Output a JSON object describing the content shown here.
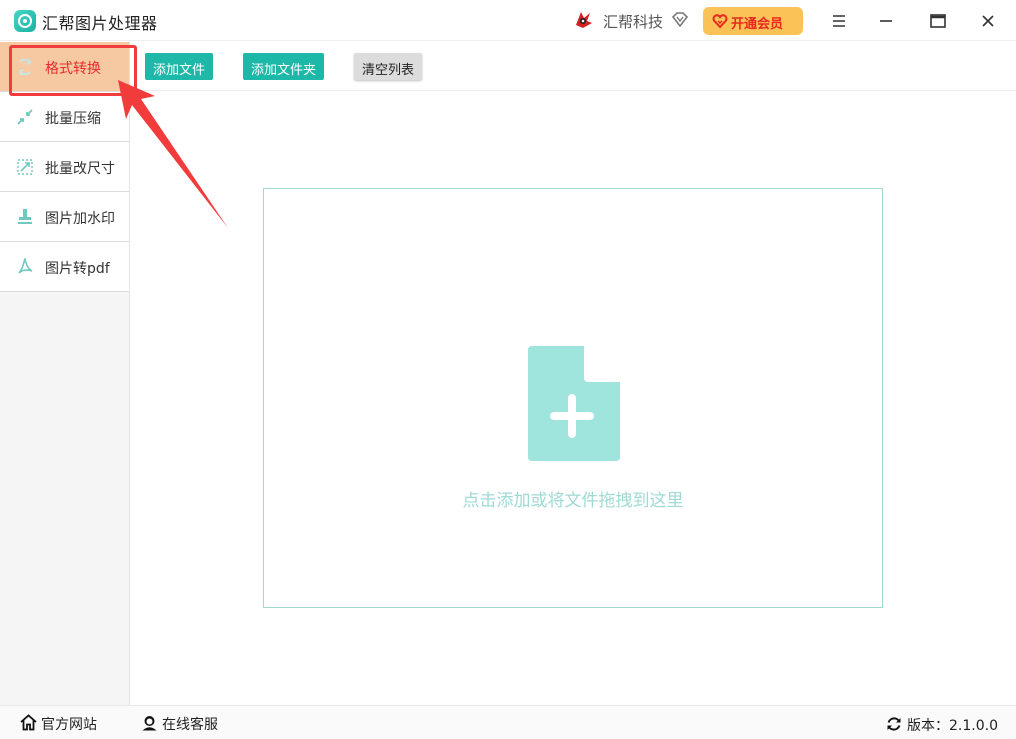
{
  "app": {
    "title": "汇帮图片处理器",
    "brand_name": "汇帮科技",
    "vip_label": "开通会员",
    "icons": [
      "app-logo-icon",
      "brand-logo-icon",
      "diamond-icon",
      "heart-icon",
      "menu-icon",
      "minimize-icon",
      "maximize-icon",
      "close-icon"
    ]
  },
  "sidebar": {
    "items": [
      {
        "label": "格式转换",
        "icon": "format-convert-icon",
        "active": true
      },
      {
        "label": "批量压缩",
        "icon": "compress-icon"
      },
      {
        "label": "批量改尺寸",
        "icon": "resize-icon"
      },
      {
        "label": "图片加水印",
        "icon": "watermark-icon"
      },
      {
        "label": "图片转pdf",
        "icon": "pdf-icon"
      }
    ]
  },
  "toolbar": {
    "add_file": "添加文件",
    "add_folder": "添加文件夹",
    "clear_list": "清空列表"
  },
  "dropzone": {
    "text": "点击添加或将文件拖拽到这里",
    "icon": "add-file-icon"
  },
  "footer": {
    "website": "官方网站",
    "support": "在线客服",
    "version": "版本：2.1.0.0"
  },
  "colors": {
    "accent": "#1eb8a8",
    "active_nav_bg": "#f7c9a3",
    "active_nav_text": "#e62c2c",
    "vip_bg": "#fbc257",
    "annotation": "#f23b3b",
    "drop_text": "#9fdad4"
  }
}
